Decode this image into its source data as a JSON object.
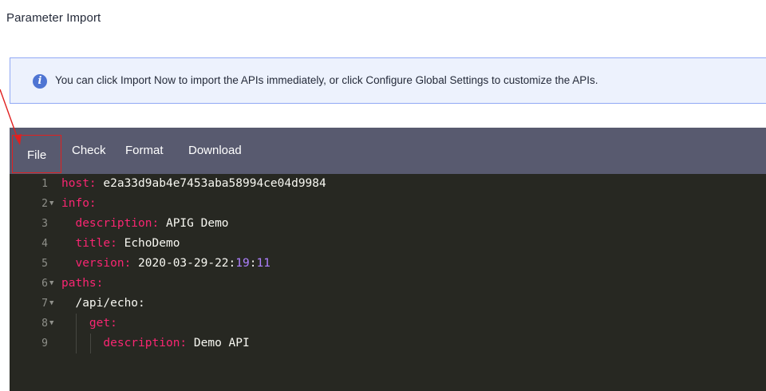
{
  "page": {
    "title": "Parameter Import"
  },
  "banner": {
    "icon": "info-icon",
    "text": "You can click Import Now to import the APIs immediately, or click Configure Global Settings to customize the APIs."
  },
  "toolbar": {
    "file_label": "File",
    "check_label": "Check",
    "format_label": "Format",
    "download_label": "Download"
  },
  "editor": {
    "lines": [
      {
        "num": "1",
        "key": "host",
        "value": "e2a33d9ab4e7453aba58994ce04d9984"
      },
      {
        "num": "2",
        "key": "info",
        "value": ""
      },
      {
        "num": "3",
        "key": "description",
        "value": "APIG Demo"
      },
      {
        "num": "4",
        "key": "title",
        "value": "EchoDemo"
      },
      {
        "num": "5",
        "key": "version",
        "value": "2020-03-29-22",
        "value_tail_1": "19",
        "value_tail_2": "11"
      },
      {
        "num": "6",
        "key": "paths",
        "value": ""
      },
      {
        "num": "7",
        "key": "/api/echo",
        "value": ""
      },
      {
        "num": "8",
        "key": "get",
        "value": ""
      },
      {
        "num": "9",
        "key": "description",
        "value": "Demo API"
      }
    ]
  },
  "colors": {
    "toolbar_bg": "#585a6f",
    "editor_bg": "#272822",
    "key": "#f92672",
    "number": "#ae81ff",
    "annotation": "#e02020",
    "info_accent": "#4f75d3"
  }
}
